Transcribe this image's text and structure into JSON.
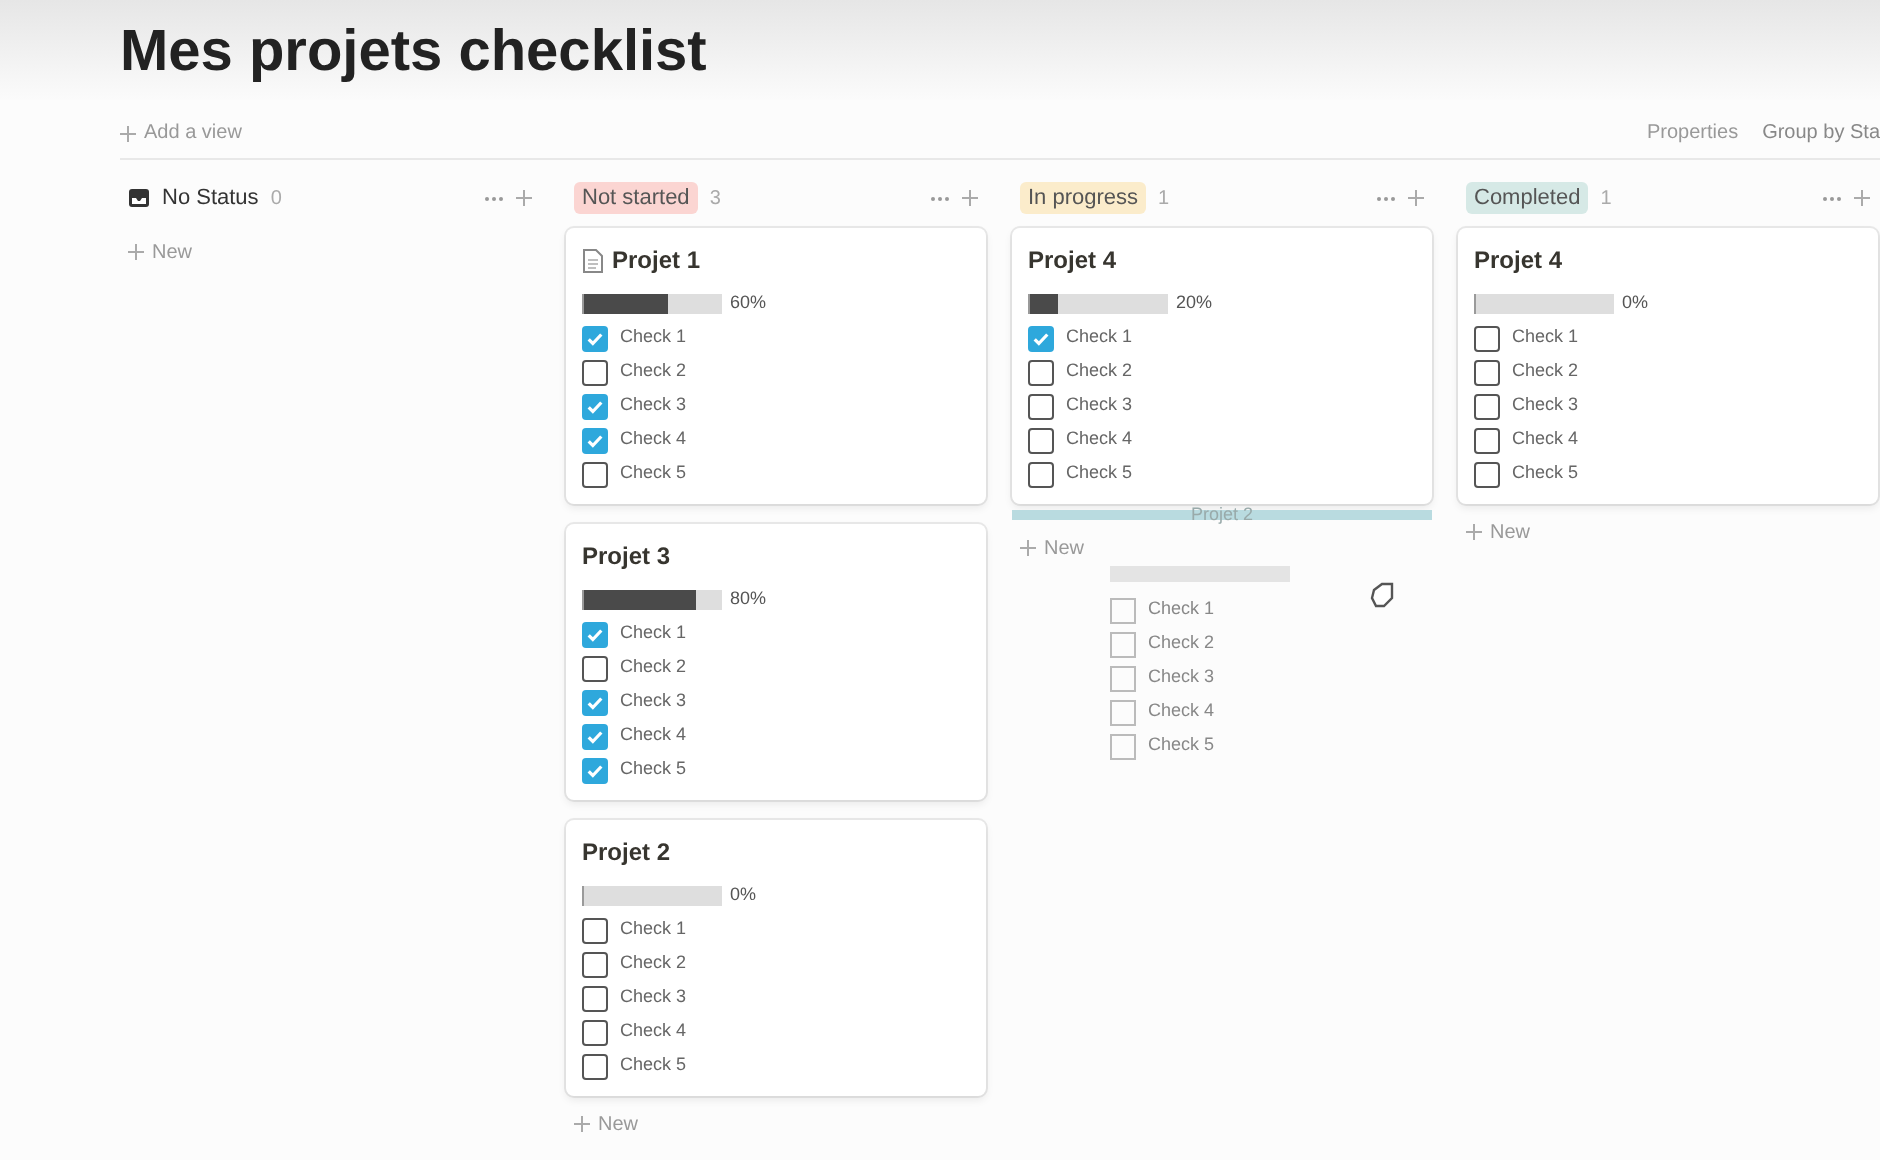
{
  "title": "Mes projets checklist",
  "toolbar": {
    "add_view": "Add a view",
    "properties": "Properties",
    "group_by": "Group by Sta"
  },
  "columns": [
    {
      "label": "No Status",
      "kind": "plain",
      "count": "0",
      "new": "New"
    },
    {
      "label": "Not started",
      "kind": "tag",
      "color": "#fbd5d2",
      "count": "3",
      "new": "New",
      "cards": [
        {
          "title": "Projet 1",
          "icon": true,
          "level": 0.6,
          "percent": "60%",
          "checks": [
            {
              "label": "Check 1",
              "checked": true
            },
            {
              "label": "Check 2",
              "checked": false
            },
            {
              "label": "Check 3",
              "checked": true
            },
            {
              "label": "Check 4",
              "checked": true
            },
            {
              "label": "Check 5",
              "checked": false
            }
          ]
        },
        {
          "title": "Projet 3",
          "icon": false,
          "level": 0.8,
          "percent": "80%",
          "checks": [
            {
              "label": "Check 1",
              "checked": true
            },
            {
              "label": "Check 2",
              "checked": false
            },
            {
              "label": "Check 3",
              "checked": true
            },
            {
              "label": "Check 4",
              "checked": true
            },
            {
              "label": "Check 5",
              "checked": true
            }
          ]
        },
        {
          "title": "Projet 2",
          "icon": false,
          "level": 0,
          "percent": "0%",
          "checks": [
            {
              "label": "Check 1",
              "checked": false
            },
            {
              "label": "Check 2",
              "checked": false
            },
            {
              "label": "Check 3",
              "checked": false
            },
            {
              "label": "Check 4",
              "checked": false
            },
            {
              "label": "Check 5",
              "checked": false
            }
          ]
        }
      ]
    },
    {
      "label": "In progress",
      "kind": "tag",
      "color": "#fbeccb",
      "count": "1",
      "new": "New",
      "drop_indicator": "Projet 2",
      "cards": [
        {
          "title": "Projet 4",
          "icon": false,
          "level": 0.2,
          "percent": "20%",
          "checks": [
            {
              "label": "Check 1",
              "checked": true
            },
            {
              "label": "Check 2",
              "checked": false
            },
            {
              "label": "Check 3",
              "checked": false
            },
            {
              "label": "Check 4",
              "checked": false
            },
            {
              "label": "Check 5",
              "checked": false
            }
          ]
        }
      ]
    },
    {
      "label": "Completed",
      "kind": "tag",
      "color": "#d6e9e6",
      "count": "1",
      "new": "New",
      "cards": [
        {
          "title": "Projet 4",
          "icon": false,
          "level": 0,
          "percent": "0%",
          "checks": [
            {
              "label": "Check 1",
              "checked": false
            },
            {
              "label": "Check 2",
              "checked": false
            },
            {
              "label": "Check 3",
              "checked": false
            },
            {
              "label": "Check 4",
              "checked": false
            },
            {
              "label": "Check 5",
              "checked": false
            }
          ]
        }
      ]
    }
  ],
  "drag_ghost": {
    "checks": [
      {
        "label": "Check 1",
        "checked": false
      },
      {
        "label": "Check 2",
        "checked": false
      },
      {
        "label": "Check 3",
        "checked": false
      },
      {
        "label": "Check 4",
        "checked": false
      },
      {
        "label": "Check 5",
        "checked": false
      }
    ]
  }
}
